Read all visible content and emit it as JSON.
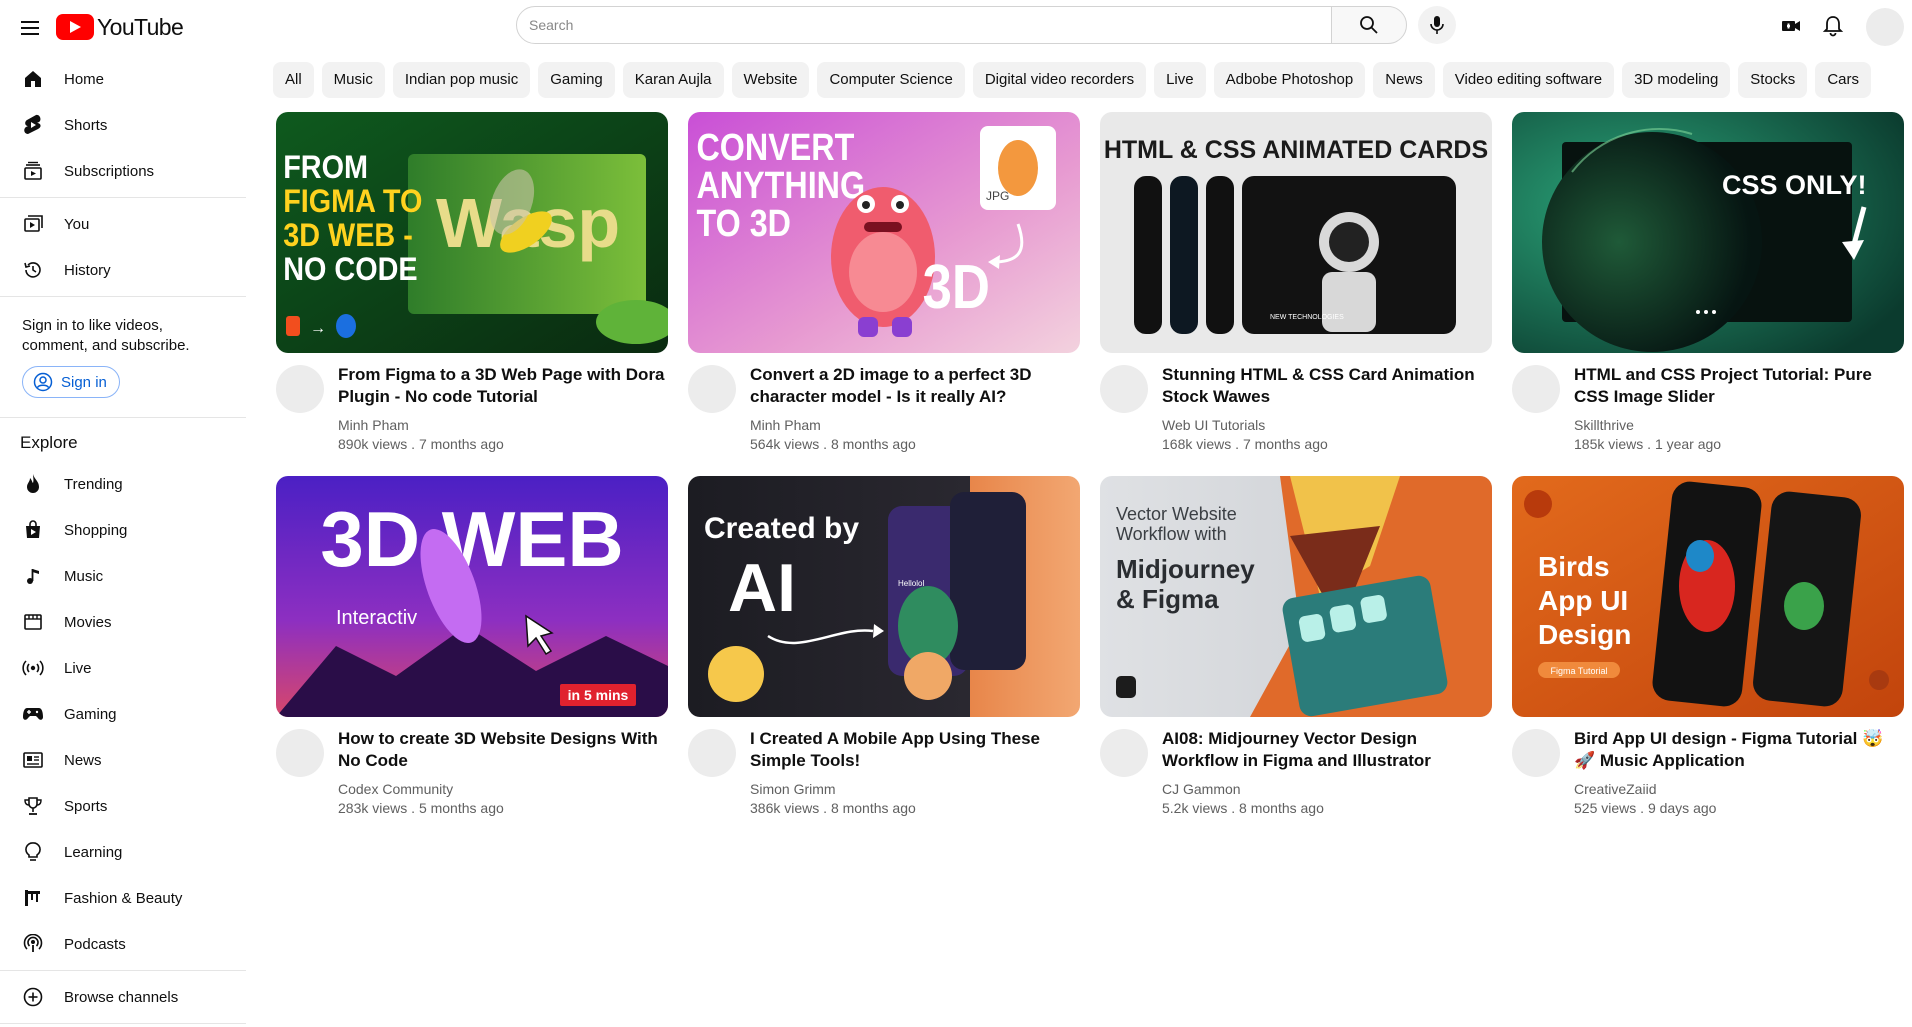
{
  "header": {
    "logo_text": "YouTube",
    "search_placeholder": "Search"
  },
  "sidebar": {
    "main": [
      {
        "label": "Home",
        "icon": "home-icon"
      },
      {
        "label": "Shorts",
        "icon": "shorts-icon"
      },
      {
        "label": "Subscriptions",
        "icon": "subscriptions-icon"
      }
    ],
    "you": [
      {
        "label": "You",
        "icon": "you-icon"
      },
      {
        "label": "History",
        "icon": "history-icon"
      }
    ],
    "signin_text": "Sign in to like videos, comment, and subscribe.",
    "signin_button": "Sign in",
    "explore_title": "Explore",
    "explore": [
      {
        "label": "Trending",
        "icon": "trending-icon"
      },
      {
        "label": "Shopping",
        "icon": "shopping-icon"
      },
      {
        "label": "Music",
        "icon": "music-icon"
      },
      {
        "label": "Movies",
        "icon": "movies-icon"
      },
      {
        "label": "Live",
        "icon": "live-icon"
      },
      {
        "label": "Gaming",
        "icon": "gaming-icon"
      },
      {
        "label": "News",
        "icon": "news-icon"
      },
      {
        "label": "Sports",
        "icon": "sports-icon"
      },
      {
        "label": "Learning",
        "icon": "learning-icon"
      },
      {
        "label": "Fashion & Beauty",
        "icon": "fashion-icon"
      },
      {
        "label": "Podcasts",
        "icon": "podcasts-icon"
      }
    ],
    "browse_channels": "Browse channels"
  },
  "chips": [
    "All",
    "Music",
    "Indian pop music",
    "Gaming",
    "Karan Aujla",
    "Website",
    "Computer Science",
    "Digital video recorders",
    "Live",
    "Adbobe Photoshop",
    "News",
    "Video editing software",
    "3D modeling",
    "Stocks",
    "Cars"
  ],
  "videos": [
    {
      "title": "From Figma to a 3D Web Page with Dora Plugin - No code Tutorial",
      "channel": "Minh Pham",
      "views": "890k views",
      "age": "7 months ago",
      "thumb_text": [
        "FROM",
        "FIGMA TO",
        "3D WEB -",
        "NO CODE"
      ],
      "thumb_extra": "Wasp"
    },
    {
      "title": "Convert a 2D image to a perfect 3D character model - Is it really AI?",
      "channel": "Minh Pham",
      "views": "564k views",
      "age": "8 months ago",
      "thumb_text": [
        "CONVERT",
        "ANYTHING",
        "TO 3D"
      ],
      "thumb_extra": "3D"
    },
    {
      "title": "Stunning HTML & CSS Card Animation Stock Wawes",
      "channel": "Web UI Tutorials",
      "views": "168k views",
      "age": "7 months ago",
      "thumb_text": [
        "HTML & CSS ANIMATED CARDS"
      ],
      "thumb_extra": "NEW TECHNOLOGIES"
    },
    {
      "title": "HTML and CSS Project Tutorial: Pure CSS Image Slider",
      "channel": "Skillthrive",
      "views": "185k views",
      "age": "1 year ago",
      "thumb_text": [
        "CSS ONLY!"
      ],
      "thumb_extra": ""
    },
    {
      "title": "How to create 3D Website Designs With No Code",
      "channel": "Codex Community",
      "views": "283k views",
      "age": "5 months ago",
      "thumb_text": [
        "3D WEB"
      ],
      "thumb_extra": "in 5 mins"
    },
    {
      "title": "I Created A Mobile App Using These Simple Tools!",
      "channel": "Simon Grimm",
      "views": "386k views",
      "age": "8 months ago",
      "thumb_text": [
        "Created by",
        "AI"
      ],
      "thumb_extra": "Hellolol"
    },
    {
      "title": "AI08: Midjourney Vector Design Workflow in Figma and Illustrator",
      "channel": "CJ Gammon",
      "views": "5.2k views",
      "age": "8 months ago",
      "thumb_text": [
        "Vector Website",
        "Workflow with",
        "Midjourney",
        "& Figma"
      ],
      "thumb_extra": ""
    },
    {
      "title": "Bird App UI design - Figma Tutorial 🤯 🚀 Music Application",
      "channel": "CreativeZaiid",
      "views": "525 views",
      "age": "9 days ago",
      "thumb_text": [
        "Birds",
        "App UI",
        "Design"
      ],
      "thumb_extra": "Figma Tutorial"
    }
  ]
}
